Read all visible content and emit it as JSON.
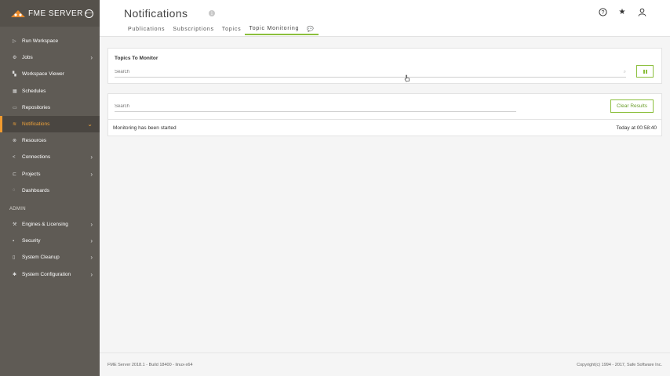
{
  "brand": {
    "name": "FME SERVER"
  },
  "sidebar": {
    "items": [
      {
        "label": "Run Workspace",
        "icon": "play-icon",
        "chevron": false
      },
      {
        "label": "Jobs",
        "icon": "jobs-icon",
        "chevron": true
      },
      {
        "label": "Workspace Viewer",
        "icon": "viewer-icon",
        "chevron": false
      },
      {
        "label": "Schedules",
        "icon": "calendar-icon",
        "chevron": false
      },
      {
        "label": "Repositories",
        "icon": "folder-icon",
        "chevron": false
      },
      {
        "label": "Notifications",
        "icon": "notifications-icon",
        "chevron": true,
        "active": true
      },
      {
        "label": "Resources",
        "icon": "resources-icon",
        "chevron": false
      },
      {
        "label": "Connections",
        "icon": "share-icon",
        "chevron": true
      },
      {
        "label": "Projects",
        "icon": "projects-icon",
        "chevron": true
      },
      {
        "label": "Dashboards",
        "icon": "dashboard-icon",
        "chevron": false
      }
    ],
    "admin_label": "ADMIN",
    "admin_items": [
      {
        "label": "Engines & Licensing",
        "icon": "engines-icon",
        "chevron": true
      },
      {
        "label": "Security",
        "icon": "lock-icon",
        "chevron": true
      },
      {
        "label": "System Cleanup",
        "icon": "cleanup-icon",
        "chevron": true
      },
      {
        "label": "System Configuration",
        "icon": "gear-icon",
        "chevron": true
      }
    ]
  },
  "header": {
    "title": "Notifications",
    "tabs": [
      {
        "label": "Publications"
      },
      {
        "label": "Subscriptions"
      },
      {
        "label": "Topics"
      },
      {
        "label": "Topic Monitoring",
        "active": true
      },
      {
        "label": "💬",
        "icon": "chat-icon"
      }
    ]
  },
  "monitor": {
    "label": "Topics To Monitor",
    "search_placeholder": "Search"
  },
  "results": {
    "search_placeholder": "Search",
    "clear_label": "Clear Results",
    "rows": [
      {
        "message": "Monitoring has been started",
        "time": "Today at 00:58:40"
      }
    ]
  },
  "footer": {
    "left": "FME Server 2018.1 - Build 18400 - linux-x64",
    "right": "Copyright(c) 1994 - 2017, Safe Software Inc."
  },
  "colors": {
    "accent_green": "#8bbf3c",
    "accent_orange": "#f29b2f",
    "sidebar_bg": "#5f5b55"
  }
}
